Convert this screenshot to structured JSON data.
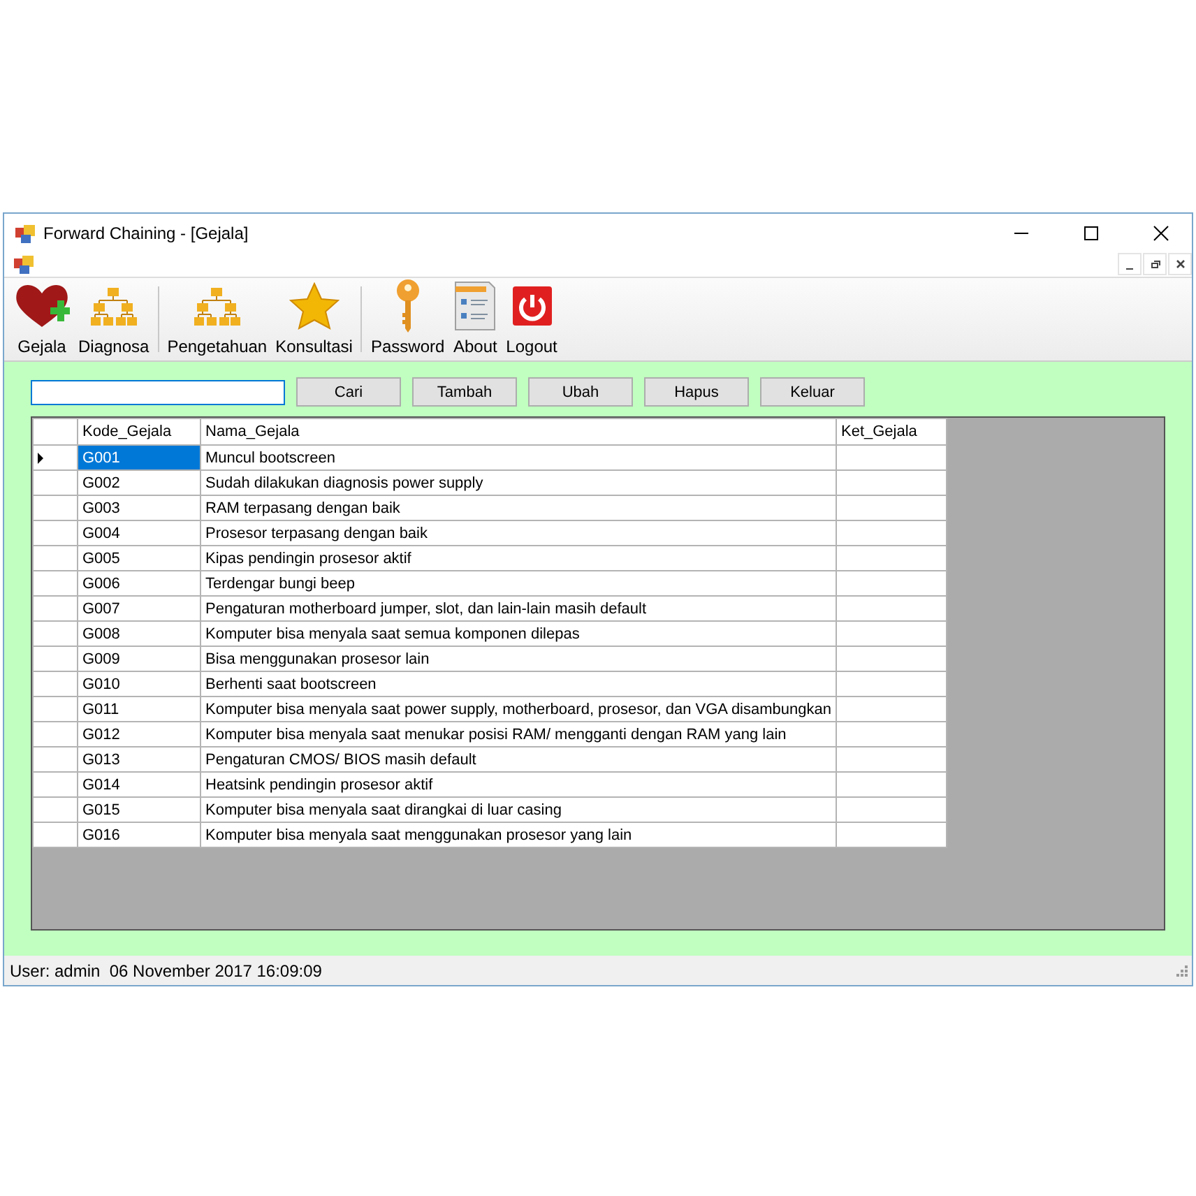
{
  "window": {
    "title": "Forward Chaining - [Gejala]"
  },
  "toolbar": [
    {
      "items": [
        {
          "label": "Gejala",
          "kind": "heart"
        },
        {
          "label": "Diagnosa",
          "kind": "hierarchy"
        }
      ]
    },
    {
      "items": [
        {
          "label": "Pengetahuan",
          "kind": "hierarchy"
        },
        {
          "label": "Konsultasi",
          "kind": "star"
        }
      ]
    },
    {
      "items": [
        {
          "label": "Password",
          "kind": "key"
        },
        {
          "label": "About",
          "kind": "document"
        },
        {
          "label": "Logout",
          "kind": "power"
        }
      ]
    }
  ],
  "buttons": [
    "Cari",
    "Tambah",
    "Ubah",
    "Hapus",
    "Keluar"
  ],
  "table": {
    "columns": [
      "Kode_Gejala",
      "Nama_Gejala",
      "Ket_Gejala"
    ],
    "rows": [
      {
        "kode": "G001",
        "nama": "Muncul bootscreen",
        "selected": true
      },
      {
        "kode": "G002",
        "nama": "Sudah dilakukan diagnosis power supply",
        "selected": false
      },
      {
        "kode": "G003",
        "nama": "RAM terpasang dengan baik",
        "selected": false
      },
      {
        "kode": "G004",
        "nama": "Prosesor terpasang dengan baik",
        "selected": false
      },
      {
        "kode": "G005",
        "nama": "Kipas pendingin prosesor aktif",
        "selected": false
      },
      {
        "kode": "G006",
        "nama": "Terdengar bungi beep",
        "selected": false
      },
      {
        "kode": "G007",
        "nama": "Pengaturan motherboard jumper, slot, dan lain-lain masih default",
        "selected": false
      },
      {
        "kode": "G008",
        "nama": "Komputer bisa menyala saat semua komponen dilepas",
        "selected": false
      },
      {
        "kode": "G009",
        "nama": "Bisa menggunakan prosesor lain",
        "selected": false
      },
      {
        "kode": "G010",
        "nama": "Berhenti saat bootscreen",
        "selected": false
      },
      {
        "kode": "G011",
        "nama": "Komputer bisa menyala saat power supply, motherboard, prosesor, dan VGA disambungkan",
        "selected": false
      },
      {
        "kode": "G012",
        "nama": "Komputer bisa menyala saat menukar posisi RAM/ mengganti dengan RAM yang lain",
        "selected": false
      },
      {
        "kode": "G013",
        "nama": "Pengaturan CMOS/ BIOS masih default",
        "selected": false
      },
      {
        "kode": "G014",
        "nama": "Heatsink pendingin prosesor aktif",
        "selected": false
      },
      {
        "kode": "G015",
        "nama": "Komputer bisa menyala saat dirangkai di luar casing",
        "selected": false
      },
      {
        "kode": "G016",
        "nama": "Komputer bisa menyala saat menggunakan prosesor yang lain",
        "selected": false
      }
    ]
  },
  "status_bar": {
    "text": "User: admin  06 November 2017 16:09:09"
  }
}
